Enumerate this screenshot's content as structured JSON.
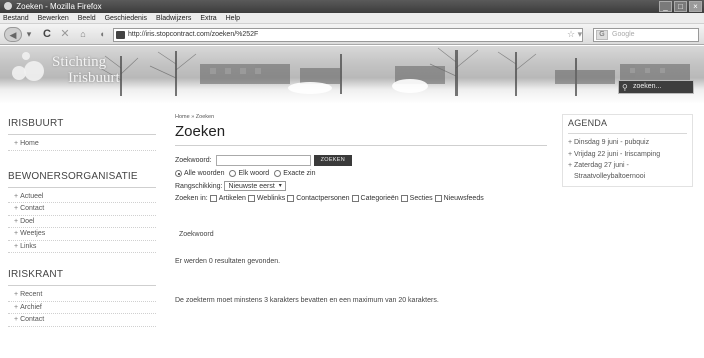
{
  "window": {
    "title": "Zoeken - Mozilla Firefox"
  },
  "menu": {
    "items": [
      "Bestand",
      "Bewerken",
      "Beeld",
      "Geschiedenis",
      "Bladwijzers",
      "Extra",
      "Help"
    ]
  },
  "browser": {
    "url": "http://iris.stopcontract.com/zoeken/%252F",
    "search_placeholder": "Google"
  },
  "site": {
    "logo_line1": "Stichting",
    "logo_line2": "Irisbuurt",
    "search_placeholder": "zoeken..."
  },
  "sidebar": {
    "groups": [
      {
        "heading": "IRISBUURT",
        "items": [
          "Home"
        ]
      },
      {
        "heading": "BEWONERSORGANISATIE",
        "items": [
          "Actueel",
          "Contact",
          "Doel",
          "Weetjes",
          "Links"
        ]
      },
      {
        "heading": "IRISKRANT",
        "items": [
          "Recent",
          "Archief",
          "Contact"
        ]
      }
    ]
  },
  "main": {
    "breadcrumb": "Home » Zoeken",
    "title": "Zoeken",
    "keyword_label": "Zoekwoord:",
    "search_button": "ZOEKEN",
    "radio_options": [
      "Alle woorden",
      "Elk woord",
      "Exacte zin"
    ],
    "radio_selected": 0,
    "ordering_label": "Rangschikking:",
    "ordering_value": "Nieuwste eerst",
    "search_in_label": "Zoeken in:",
    "areas": [
      "Artikelen",
      "Weblinks",
      "Contactpersonen",
      "Categorieën",
      "Secties",
      "Nieuwsfeeds"
    ],
    "result_keyword": "Zoekwoord",
    "result_count": "Er werden 0 resultaten gevonden.",
    "result_message": "De zoekterm moet minstens 3 karakters bevatten en een maximum van 20 karakters."
  },
  "agenda": {
    "heading": "AGENDA",
    "items": [
      "Dinsdag 9 juni - pubquiz",
      "Vrijdag 22 juni - Iriscamping",
      "Zaterdag 27 juni - Straatvolleybaltoernooi"
    ]
  }
}
